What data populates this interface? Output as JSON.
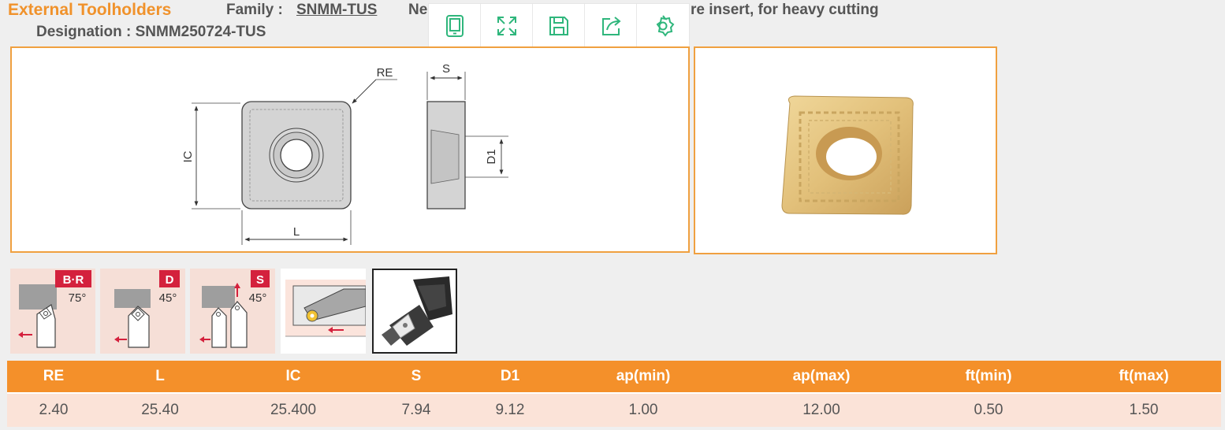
{
  "header": {
    "title": "External Toolholders",
    "family_label": "Family :",
    "family_value": "SNMM-TUS",
    "description_left": "Ne",
    "description_right": "re insert, for heavy cutting",
    "designation": "Designation : SNMM250724-TUS"
  },
  "toolbar": {
    "items": [
      {
        "name": "tablet-icon"
      },
      {
        "name": "fullscreen-icon"
      },
      {
        "name": "save-icon"
      },
      {
        "name": "share-icon"
      },
      {
        "name": "settings-icon"
      }
    ],
    "accent": "#2fb67c"
  },
  "drawing": {
    "labels": {
      "re": "RE",
      "s": "S",
      "ic": "IC",
      "d1": "D1",
      "l": "L"
    }
  },
  "holders": [
    {
      "code": "B·R",
      "angle": "75°",
      "icon": "insert-holder-75-icon"
    },
    {
      "code": "D",
      "angle": "45°",
      "icon": "insert-holder-45-icon"
    },
    {
      "code": "S",
      "angle": "45°",
      "icon": "insert-holder-45-dual-icon"
    },
    {
      "code": "",
      "angle": "",
      "icon": "boring-bar-icon"
    },
    {
      "code": "",
      "angle": "",
      "icon": "toolholder-photo-icon",
      "selected": true
    }
  ],
  "table": {
    "columns": [
      "RE",
      "L",
      "IC",
      "S",
      "D1",
      "ap(min)",
      "ap(max)",
      "ft(min)",
      "ft(max)"
    ],
    "rows": [
      [
        "2.40",
        "25.40",
        "25.400",
        "7.94",
        "9.12",
        "1.00",
        "12.00",
        "0.50",
        "1.50"
      ]
    ]
  },
  "colors": {
    "accent": "#f0922b",
    "row_bg": "#fbe3d8",
    "thumb_bg": "#f6dfd7",
    "badge": "#d4213d"
  }
}
